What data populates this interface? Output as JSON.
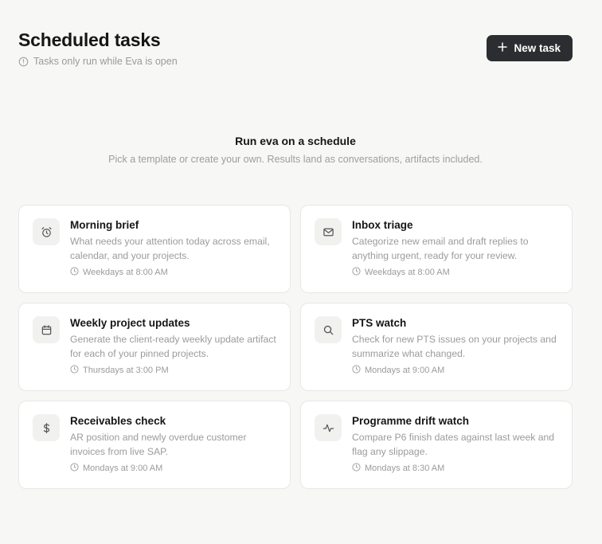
{
  "header": {
    "title": "Scheduled tasks",
    "subtitle": "Tasks only run while Eva is open",
    "new_task_label": "New task"
  },
  "hero": {
    "title": "Run eva on a schedule",
    "subtitle": "Pick a template or create your own. Results land as conversations, artifacts included."
  },
  "templates": [
    {
      "icon": "alarm-clock-icon",
      "title": "Morning brief",
      "description": "What needs your attention today across email, calendar, and your projects.",
      "schedule": "Weekdays at 8:00 AM"
    },
    {
      "icon": "envelope-icon",
      "title": "Inbox triage",
      "description": "Categorize new email and draft replies to anything urgent, ready for your review.",
      "schedule": "Weekdays at 8:00 AM"
    },
    {
      "icon": "calendar-icon",
      "title": "Weekly project updates",
      "description": "Generate the client-ready weekly update artifact for each of your pinned projects.",
      "schedule": "Thursdays at 3:00 PM"
    },
    {
      "icon": "search-icon",
      "title": "PTS watch",
      "description": "Check for new PTS issues on your projects and summarize what changed.",
      "schedule": "Mondays at 9:00 AM"
    },
    {
      "icon": "dollar-icon",
      "title": "Receivables check",
      "description": "AR position and newly overdue customer invoices from live SAP.",
      "schedule": "Mondays at 9:00 AM"
    },
    {
      "icon": "activity-pulse-icon",
      "title": "Programme drift watch",
      "description": "Compare P6 finish dates against last week and flag any slippage.",
      "schedule": "Mondays at 8:30 AM"
    }
  ]
}
